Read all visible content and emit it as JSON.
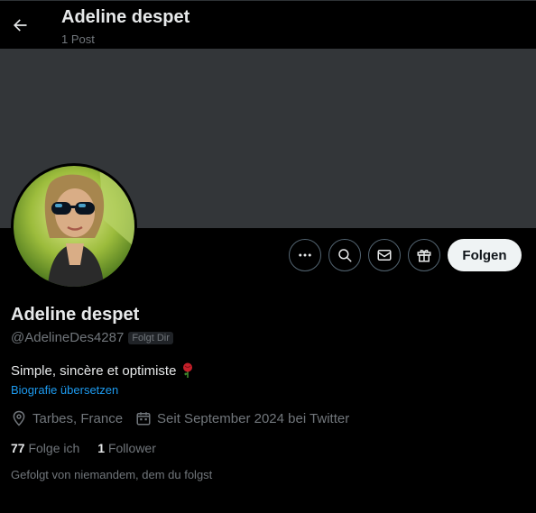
{
  "header": {
    "title": "Adeline despet",
    "post_count": "1 Post"
  },
  "profile": {
    "display_name": "Adeline despet",
    "handle": "@AdelineDes4287",
    "follows_you_badge": "Folgt Dir",
    "bio": "Simple, sincère et optimiste",
    "bio_emoji": "rose",
    "translate_bio": "Biografie übersetzen",
    "location": "Tarbes, France",
    "joined": "Seit September 2024 bei Twitter",
    "following_count": "77",
    "following_label": "Folge ich",
    "followers_count": "1",
    "followers_label": "Follower",
    "followed_by_text": "Gefolgt von niemandem, dem du folgst"
  },
  "actions": {
    "follow_label": "Folgen",
    "icons": [
      "more-icon",
      "search-icon",
      "message-icon",
      "gift-icon"
    ]
  },
  "colors": {
    "background": "#000000",
    "banner": "#333639",
    "accent": "#1d9bf0",
    "secondary_text": "#71767b",
    "follow_button": "#eff3f4"
  }
}
